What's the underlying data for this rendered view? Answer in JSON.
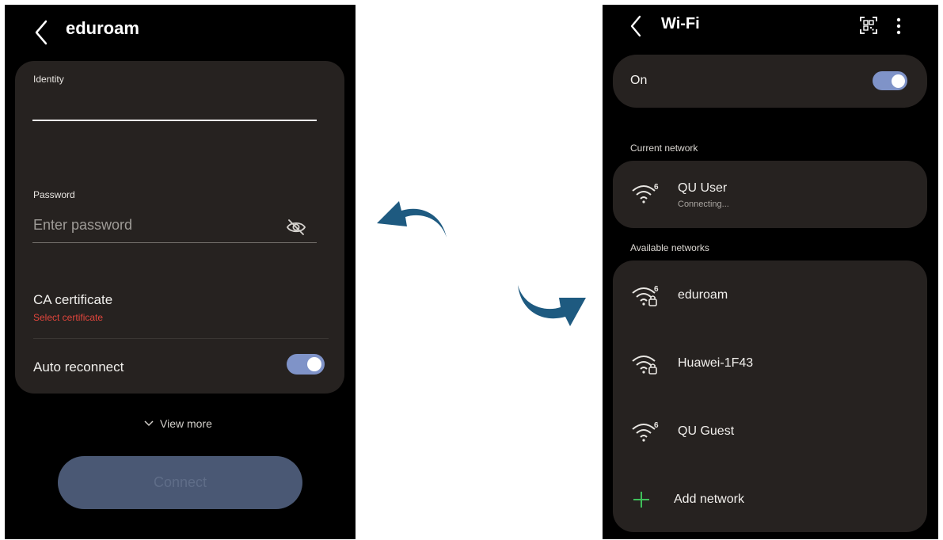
{
  "left_screen": {
    "title": "eduroam",
    "identity_label": "Identity",
    "password_label": "Password",
    "password_placeholder": "Enter password",
    "ca_certificate_label": "CA certificate",
    "ca_certificate_value": "Select certificate",
    "auto_reconnect_label": "Auto reconnect",
    "auto_reconnect_on": true,
    "view_more_label": "View more",
    "connect_label": "Connect"
  },
  "right_screen": {
    "title": "Wi-Fi",
    "wifi_toggle_label": "On",
    "wifi_on": true,
    "current_network_header": "Current network",
    "current_network": {
      "name": "QU User",
      "status": "Connecting...",
      "badge": "6",
      "secured": false
    },
    "available_networks_header": "Available networks",
    "available_networks": [
      {
        "name": "eduroam",
        "badge": "6",
        "secured": true
      },
      {
        "name": "Huawei-1F43",
        "badge": "",
        "secured": true
      },
      {
        "name": "QU Guest",
        "badge": "6",
        "secured": false
      }
    ],
    "add_network_label": "Add network"
  },
  "colors": {
    "card_background": "#262220",
    "toggle_accent": "#7f93c8",
    "error_red": "#e0453c",
    "add_green": "#3fbf5a",
    "arrow_blue": "#1e5a80",
    "connect_disabled": "#4a5874"
  },
  "icons": [
    "back-icon",
    "eye-off-icon",
    "chevron-down-icon",
    "qr-code-icon",
    "more-options-icon",
    "wifi-icon",
    "lock-icon",
    "plus-icon",
    "curved-arrow-icon"
  ]
}
